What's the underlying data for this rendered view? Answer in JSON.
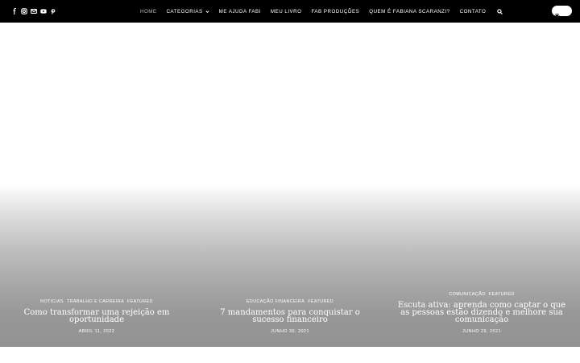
{
  "social": [
    {
      "name": "facebook-icon"
    },
    {
      "name": "instagram-icon"
    },
    {
      "name": "mail-icon"
    },
    {
      "name": "youtube-icon"
    },
    {
      "name": "pinterest-icon"
    }
  ],
  "nav": {
    "items": [
      {
        "label": "HOME",
        "active": true
      },
      {
        "label": "CATEGORIAS",
        "has_dropdown": true
      },
      {
        "label": "ME AJUDA FABI"
      },
      {
        "label": "MEU LIVRO"
      },
      {
        "label": "FAB PRODUÇÕES"
      },
      {
        "label": "QUEM É FABIANA SCARANZI?"
      },
      {
        "label": "CONTATO"
      }
    ],
    "search_icon": "search-icon"
  },
  "theme_toggle": {
    "icon": "sun-icon"
  },
  "slides": [
    {
      "categories": [
        "NOTICIAS",
        "TRABALHO E CARREIRA",
        "FEATURED"
      ],
      "title": "Como transformar uma rejeição em oportunidade",
      "date": "ABRIL 11, 2022"
    },
    {
      "categories": [
        "EDUCAÇÃO FINANCEIRA",
        "FEATURED"
      ],
      "title": "7 mandamentos para conquistar o sucesso financeiro",
      "date": "JUNHO 30, 2021"
    },
    {
      "categories": [
        "COMUNICAÇÃO",
        "FEATURED"
      ],
      "title": "Escuta ativa: aprenda como captar o que as pessoas estão dizendo e melhore sua comunicação",
      "date": "JUNHO 29, 2021"
    }
  ],
  "colors": {
    "topbar_bg": "#000000",
    "nav_text": "#ffffff",
    "nav_active": "#b9b9b9"
  }
}
